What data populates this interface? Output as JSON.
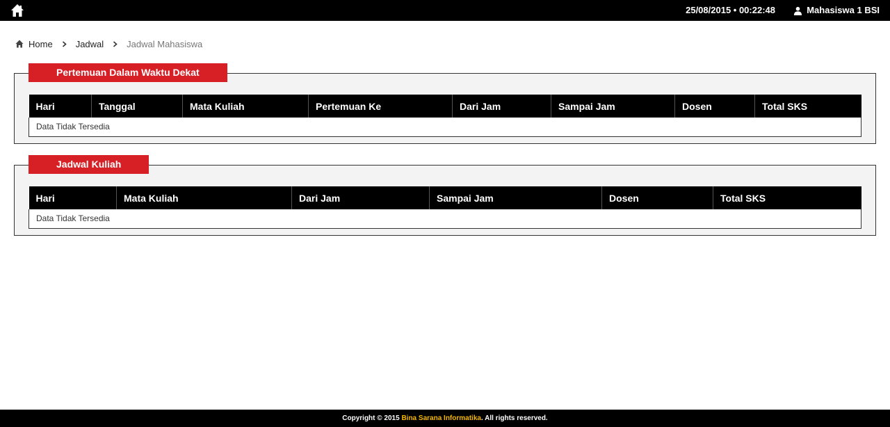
{
  "topbar": {
    "home_icon": "home-icon",
    "datetime": "25/08/2015 • 00:22:48",
    "user_icon": "user-icon",
    "user_name": "Mahasiswa 1 BSI"
  },
  "breadcrumb": {
    "icon": "home-icon",
    "items": [
      "Home",
      "Jadwal"
    ],
    "current": "Jadwal Mahasiswa"
  },
  "upcoming": {
    "title": "Pertemuan Dalam Waktu Dekat",
    "columns": [
      "Hari",
      "Tanggal",
      "Mata Kuliah",
      "Pertemuan Ke",
      "Dari Jam",
      "Sampai Jam",
      "Dosen",
      "Total SKS"
    ],
    "empty_text": "Data Tidak Tersedia"
  },
  "schedule": {
    "title": "Jadwal Kuliah",
    "columns": [
      "Hari",
      "Mata Kuliah",
      "Dari Jam",
      "Sampai Jam",
      "Dosen",
      "Total SKS"
    ],
    "empty_text": "Data Tidak Tersedia"
  },
  "footer": {
    "prefix": "Copyright © 2015",
    "brand": "Bina Sarana Informatika",
    "suffix": ". All rights reserved."
  },
  "colors": {
    "topbar": "#000000",
    "accent": "#d71f26",
    "brand_link": "#f5b800",
    "panel_bg": "#f3f3f3"
  }
}
